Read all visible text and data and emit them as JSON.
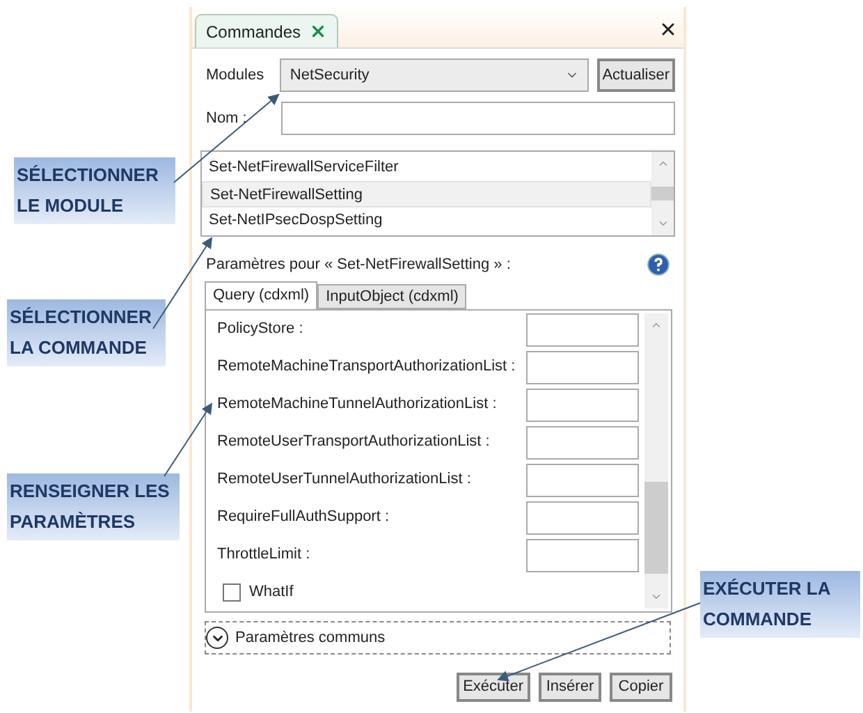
{
  "tab": {
    "label": "Commandes"
  },
  "modules": {
    "label": "Modules",
    "value": "NetSecurity"
  },
  "refresh_button": "Actualiser",
  "name_field": {
    "label": "Nom :"
  },
  "commands": [
    {
      "name": "Set-NetFirewallServiceFilter",
      "selected": false
    },
    {
      "name": "Set-NetFirewallSetting",
      "selected": true
    },
    {
      "name": "Set-NetIPsecDospSetting",
      "selected": false
    }
  ],
  "params_title": "Paramètres pour « Set-NetFirewallSetting » :",
  "param_tabs": [
    {
      "label": "Query (cdxml)",
      "selected": true
    },
    {
      "label": "InputObject (cdxml)",
      "selected": false
    }
  ],
  "parameters": [
    {
      "kind": "text",
      "label": "PolicyStore :"
    },
    {
      "kind": "text",
      "label": "RemoteMachineTransportAuthorizationList :"
    },
    {
      "kind": "text",
      "label": "RemoteMachineTunnelAuthorizationList :"
    },
    {
      "kind": "text",
      "label": "RemoteUserTransportAuthorizationList :"
    },
    {
      "kind": "text",
      "label": "RemoteUserTunnelAuthorizationList :"
    },
    {
      "kind": "text",
      "label": "RequireFullAuthSupport :"
    },
    {
      "kind": "text",
      "label": "ThrottleLimit :"
    },
    {
      "kind": "checkbox",
      "label": "WhatIf",
      "checked": false
    }
  ],
  "common_params": {
    "label": "Paramètres communs",
    "expanded": false
  },
  "buttons": [
    "Exécuter",
    "Insérer",
    "Copier"
  ],
  "annotations": [
    {
      "lines": [
        "SÉLECTIONNER",
        "LE MODULE"
      ]
    },
    {
      "lines": [
        "SÉLECTIONNER",
        "LA COMMANDE"
      ]
    },
    {
      "lines": [
        "RENSEIGNER LES",
        "PARAMÈTRES"
      ]
    },
    {
      "lines": [
        "EXÉCUTER LA",
        "COMMANDE"
      ]
    }
  ]
}
